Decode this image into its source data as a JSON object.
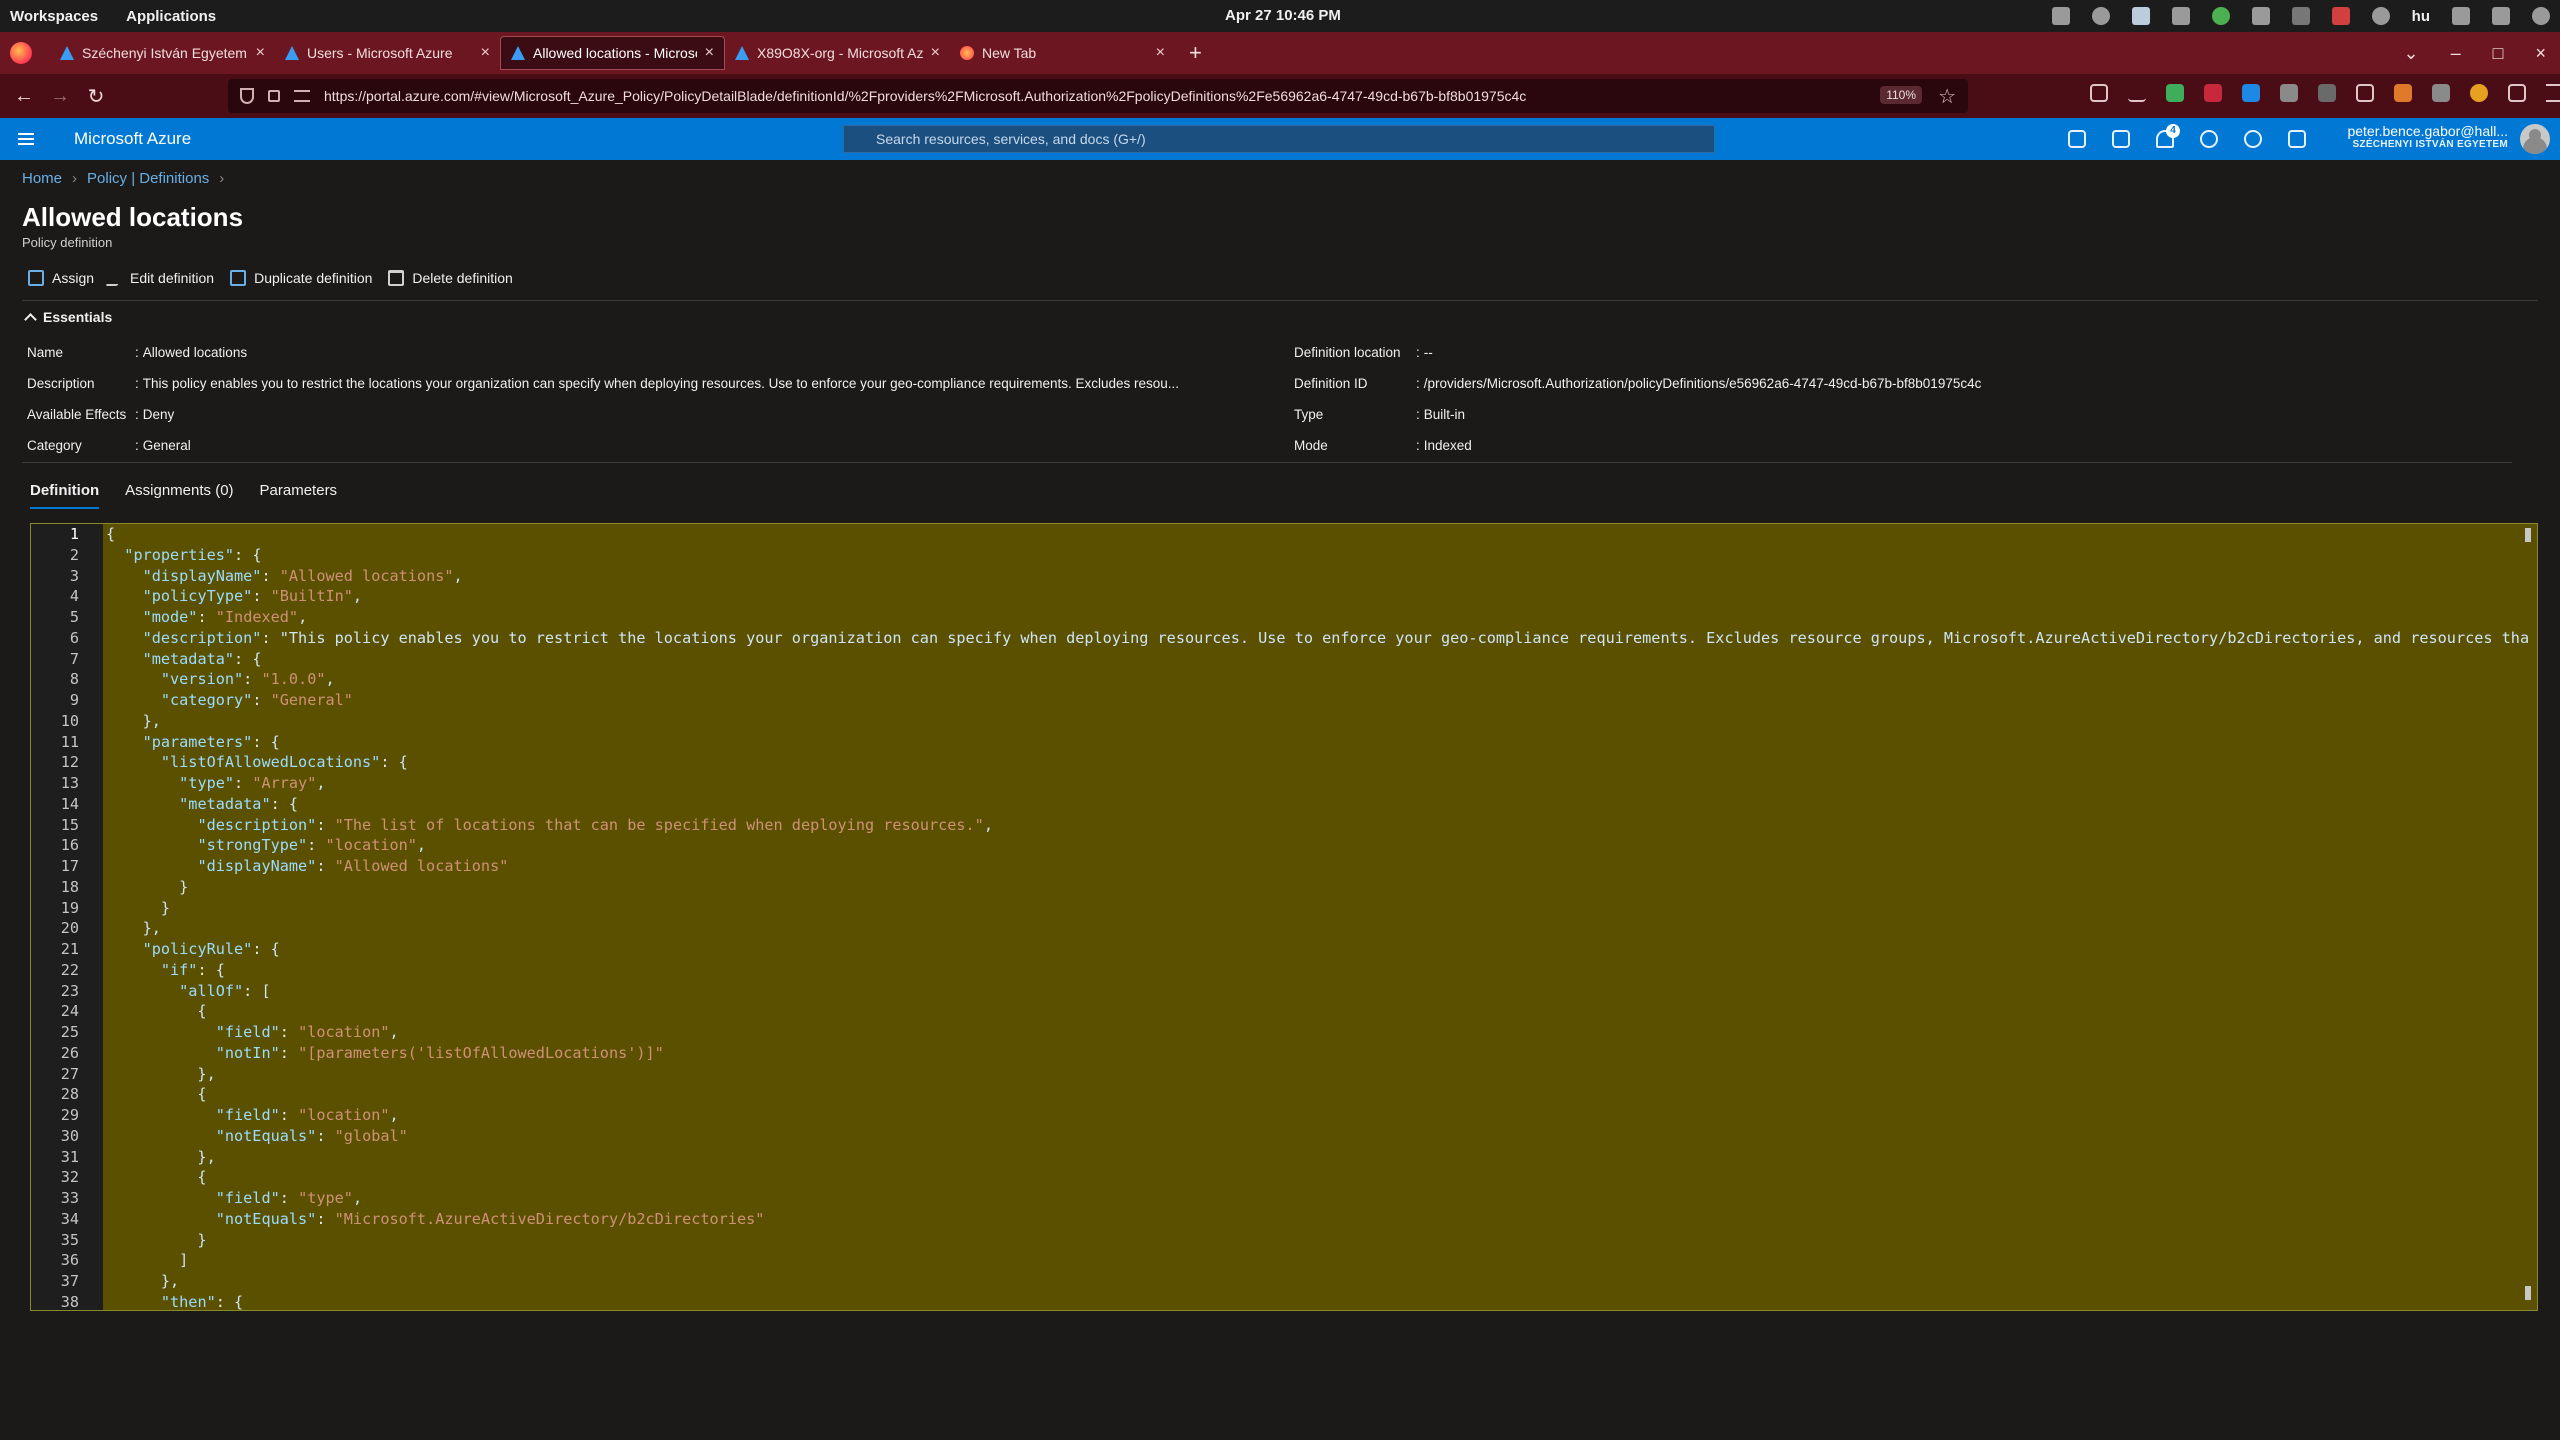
{
  "os": {
    "workspaces": "Workspaces",
    "applications": "Applications",
    "clock": "Apr 27  10:46 PM",
    "lang": "hu"
  },
  "browser": {
    "tabs": [
      {
        "title": "Széchenyi István Egyetem -",
        "icon": "azure-icon"
      },
      {
        "title": "Users - Microsoft Azure",
        "icon": "azure-icon"
      },
      {
        "title": "Allowed locations - Microso",
        "icon": "azure-icon",
        "active": true
      },
      {
        "title": "X89O8X-org - Microsoft Azu",
        "icon": "azure-icon"
      },
      {
        "title": "New Tab",
        "icon": "firefox-icon"
      }
    ],
    "new_tab": "+",
    "url": "https://portal.azure.com/#view/Microsoft_Azure_Policy/PolicyDetailBlade/definitionId/%2Fproviders%2FMicrosoft.Authorization%2FpolicyDefinitions%2Fe56962a6-4747-49cd-b67b-bf8b01975c4c",
    "zoom": "110%"
  },
  "azure": {
    "brand": "Microsoft Azure",
    "search_placeholder": "Search resources, services, and docs (G+/)",
    "notification_count": "4",
    "user": "peter.bence.gabor@hall...",
    "org": "SZÉCHENYI ISTVÁN EGYETEM"
  },
  "breadcrumb": [
    "Home",
    "Policy | Definitions"
  ],
  "page": {
    "title": "Allowed locations",
    "subtitle": "Policy definition"
  },
  "toolbar": {
    "assign": "Assign",
    "edit": "Edit definition",
    "duplicate": "Duplicate definition",
    "delete": "Delete definition"
  },
  "essentials": {
    "label": "Essentials",
    "left": [
      {
        "label": "Name",
        "value": "Allowed locations"
      },
      {
        "label": "Description",
        "value": "This policy enables you to restrict the locations your organization can specify when deploying resources. Use to enforce your geo-compliance requirements. Excludes resou..."
      },
      {
        "label": "Available Effects",
        "value": "Deny"
      },
      {
        "label": "Category",
        "value": "General"
      }
    ],
    "right": [
      {
        "label": "Definition location",
        "value": "--"
      },
      {
        "label": "Definition ID",
        "value": "/providers/Microsoft.Authorization/policyDefinitions/e56962a6-4747-49cd-b67b-bf8b01975c4c"
      },
      {
        "label": "Type",
        "value": "Built-in"
      },
      {
        "label": "Mode",
        "value": "Indexed"
      }
    ]
  },
  "tabs": [
    {
      "label": "Definition",
      "active": true
    },
    {
      "label": "Assignments (0)"
    },
    {
      "label": "Parameters"
    }
  ],
  "code": {
    "lines": [
      "{",
      "  \"properties\": {",
      "    \"displayName\": \"Allowed locations\",",
      "    \"policyType\": \"BuiltIn\",",
      "    \"mode\": \"Indexed\",",
      "    \"description\": \"This policy enables you to restrict the locations your organization can specify when deploying resources. Use to enforce your geo-compliance requirements. Excludes resource groups, Microsoft.AzureActiveDirectory/b2cDirectories, and resources tha",
      "    \"metadata\": {",
      "      \"version\": \"1.0.0\",",
      "      \"category\": \"General\"",
      "    },",
      "    \"parameters\": {",
      "      \"listOfAllowedLocations\": {",
      "        \"type\": \"Array\",",
      "        \"metadata\": {",
      "          \"description\": \"The list of locations that can be specified when deploying resources.\",",
      "          \"strongType\": \"location\",",
      "          \"displayName\": \"Allowed locations\"",
      "        }",
      "      }",
      "    },",
      "    \"policyRule\": {",
      "      \"if\": {",
      "        \"allOf\": [",
      "          {",
      "            \"field\": \"location\",",
      "            \"notIn\": \"[parameters('listOfAllowedLocations')]\"",
      "          },",
      "          {",
      "            \"field\": \"location\",",
      "            \"notEquals\": \"global\"",
      "          },",
      "          {",
      "            \"field\": \"type\",",
      "            \"notEquals\": \"Microsoft.AzureActiveDirectory/b2cDirectories\"",
      "          }",
      "        ]",
      "      },",
      "      \"then\": {"
    ]
  }
}
